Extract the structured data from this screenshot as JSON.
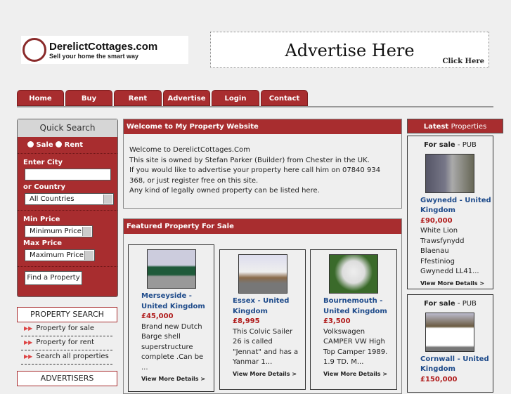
{
  "header": {
    "logo_title": "DerelictCottages.com",
    "logo_tagline": "Sell your home the smart way",
    "ad_title": "Advertise Here",
    "ad_click": "Click Here"
  },
  "nav": [
    "Home",
    "Buy",
    "Rent",
    "Advertise",
    "Login",
    "Contact"
  ],
  "quick_search": {
    "title": "Quick Search",
    "sale": "Sale",
    "rent": "Rent",
    "city_label": "Enter City",
    "city_value": "",
    "country_label": "or Country",
    "country_value": "All Countries",
    "min_label": "Min Price",
    "min_value": "Minimum Price",
    "max_label": "Max Price",
    "max_value": "Maximum Price",
    "find_button": "Find a Property"
  },
  "property_search": {
    "title": "PROPERTY SEARCH",
    "links": [
      "Property for sale",
      "Property for rent",
      "Search all properties"
    ]
  },
  "advertisers": {
    "title": "ADVERTISERS"
  },
  "welcome": {
    "title": "Welcome to My Property Website",
    "lines": [
      "Welcome to DerelictCottages.Com",
      "This site is owned by Stefan Parker (Builder) from Chester in the UK.",
      "If you would like to advertise your property here call him on 07840 934 368, or just register free on this site.",
      "Any kind of legally owned property can be listed here."
    ]
  },
  "featured": {
    "title": "Featured Property For Sale",
    "items": [
      {
        "location": "Merseyside - United Kingdom",
        "price": "£45,000",
        "desc": "Brand new Dutch Barge shell superstructure complete .Can be ...",
        "more": "View More Details >"
      },
      {
        "location": "Essex - United Kingdom",
        "price": "£8,995",
        "desc": "This Colvic Sailer 26 is called \"Jennat\" and has a Yanmar 1...",
        "more": "View More Details >"
      },
      {
        "location": "Bournemouth - United Kingdom",
        "price": "£3,500",
        "desc": "Volkswagen CAMPER VW High Top Camper 1989. 1.9 TD. M...",
        "more": "View More Details >"
      }
    ]
  },
  "latest": {
    "title_bold": "Latest",
    "title_rest": "Properties",
    "items": [
      {
        "status": "For sale",
        "type": "- PUB",
        "location": "Gwynedd - United Kingdom",
        "price": "£90,000",
        "desc": "White Lion Trawsfynydd Blaenau Ffestiniog Gwynedd LL41...",
        "more": "View More Details >"
      },
      {
        "status": "For sale",
        "type": "- PUB",
        "location": "Cornwall - United Kingdom",
        "price": "£150,000"
      }
    ]
  }
}
